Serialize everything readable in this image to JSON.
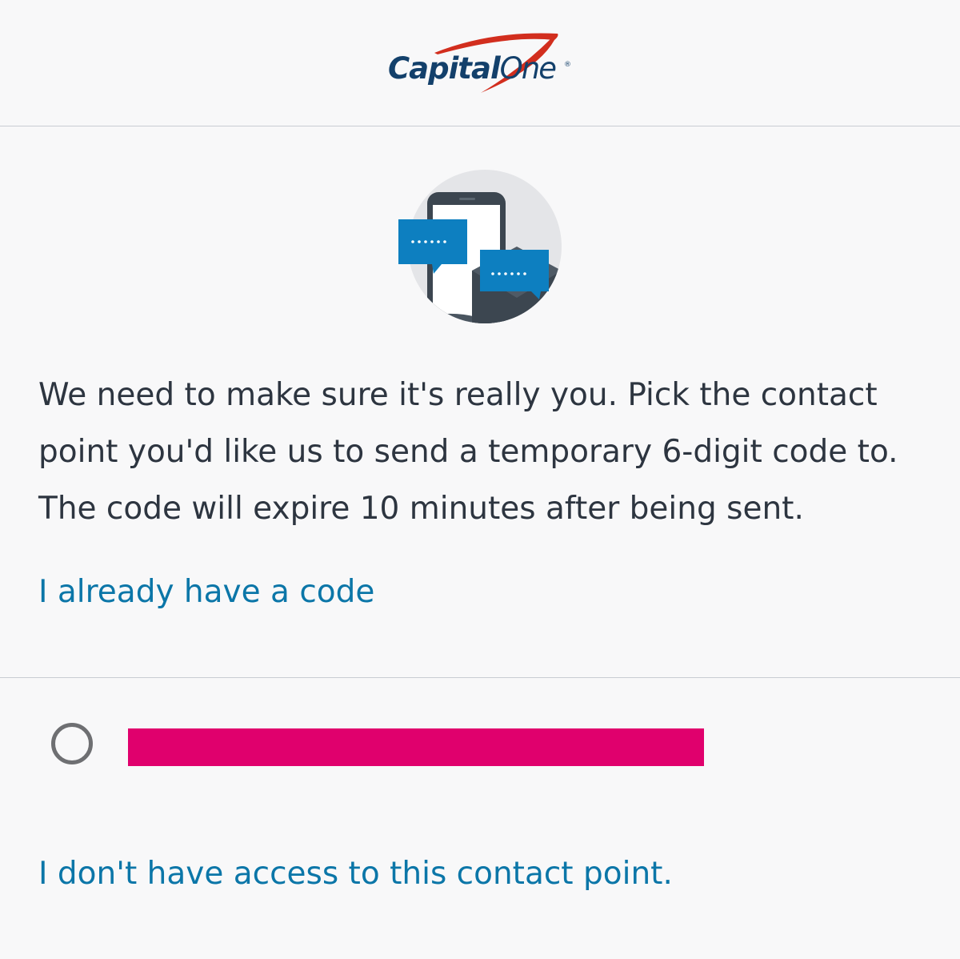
{
  "header": {
    "logo": {
      "word_main": "Capital",
      "word_one": "One",
      "registered": "®"
    }
  },
  "illustration": {
    "icon": "phone-with-chat-bubbles-icon"
  },
  "main": {
    "message": "We need to make sure it's really you. Pick the contact point you'd like us to send a temporary 6-digit code to. The code will expire 10 minutes after being sent.",
    "already_have_code_link": "I already have a code"
  },
  "contact_options": [
    {
      "selected": false,
      "redacted": true
    }
  ],
  "footer_link": "I don't have access to this contact point.",
  "colors": {
    "background": "#f8f8f9",
    "text": "#2d3540",
    "link": "#0b76a8",
    "logo_blue": "#13406b",
    "logo_red": "#d22e1e",
    "redaction": "#e0006d",
    "bubble_blue": "#0d7fc0"
  }
}
